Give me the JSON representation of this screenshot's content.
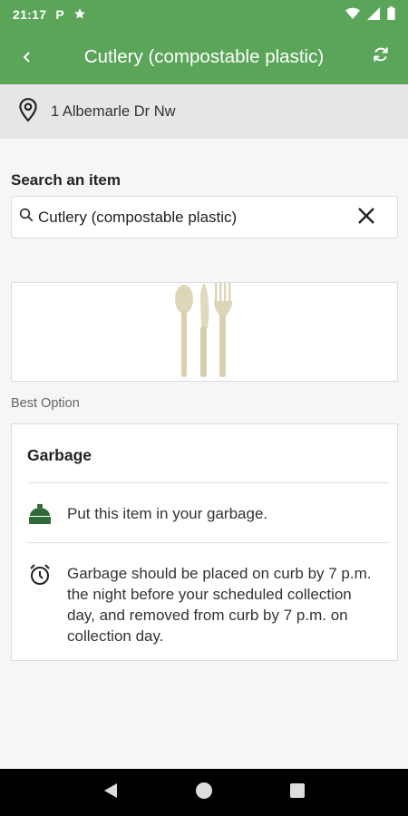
{
  "status_bar": {
    "time": "21:17",
    "icons": [
      "parking-icon",
      "star-icon",
      "wifi-icon",
      "signal-icon",
      "battery-icon"
    ]
  },
  "app_bar": {
    "title": "Cutlery (compostable plastic)",
    "back_icon": "chevron-left-icon",
    "refresh_icon": "refresh-icon"
  },
  "address": {
    "icon": "location-pin-icon",
    "text": "1 Albemarle Dr Nw"
  },
  "search": {
    "label": "Search an item",
    "value": "Cutlery (compostable plastic)",
    "icon": "search-icon",
    "clear_icon": "close-icon"
  },
  "item_image": {
    "description_icon": "cutlery-image"
  },
  "best_option_label": "Best Option",
  "disposal": {
    "title": "Garbage",
    "instructions": [
      {
        "icon": "garbage-bin-icon",
        "text": "Put this item in your garbage."
      },
      {
        "icon": "alarm-clock-icon",
        "text": "Garbage should be placed on curb by 7 p.m. the night before your scheduled collection day, and removed from curb by 7 p.m. on collection day."
      }
    ]
  },
  "colors": {
    "primary": "#5aa55a",
    "bin_green": "#2f6b3a"
  }
}
